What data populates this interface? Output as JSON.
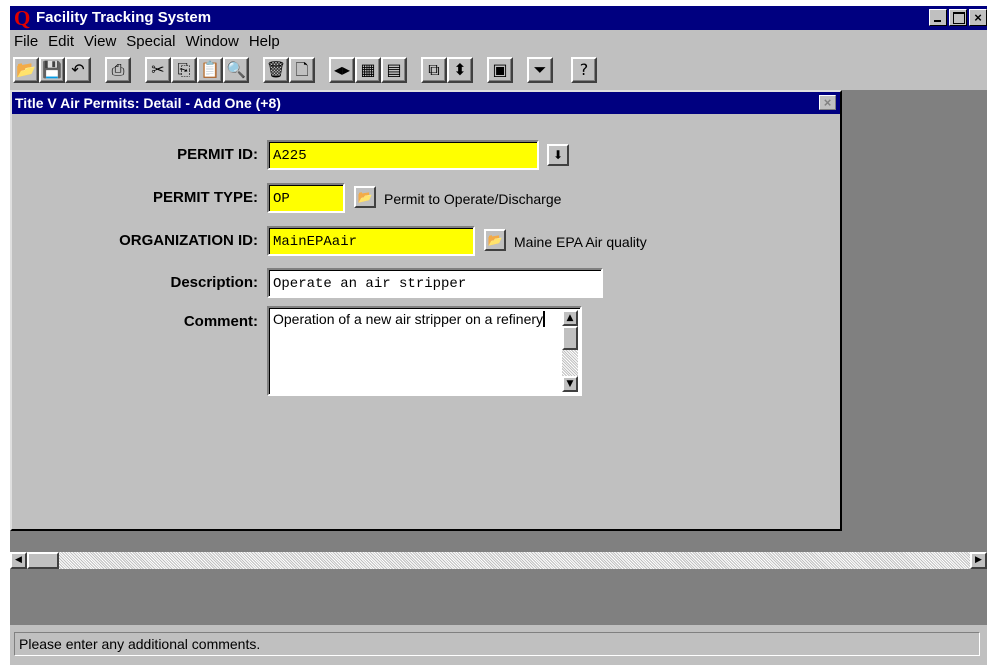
{
  "app": {
    "logo": "Q",
    "title": "Facility Tracking System",
    "window_controls": {
      "minimize": "_",
      "maximize": "□",
      "close": "×"
    }
  },
  "menu": [
    {
      "label": "File"
    },
    {
      "label": "Edit"
    },
    {
      "label": "View"
    },
    {
      "label": "Special"
    },
    {
      "label": "Window"
    },
    {
      "label": "Help"
    }
  ],
  "toolbar": {
    "buttons": [
      {
        "icon": "open-folder-icon",
        "glyph": "📂"
      },
      {
        "icon": "save-disk-icon",
        "glyph": "💾"
      },
      {
        "icon": "undo-icon",
        "glyph": "↶"
      },
      {
        "icon": "print-icon",
        "glyph": "⎙"
      },
      {
        "icon": "cut-icon",
        "glyph": "✂"
      },
      {
        "icon": "copy-icon",
        "glyph": "⎘"
      },
      {
        "icon": "paste-icon",
        "glyph": "📋"
      },
      {
        "icon": "find-icon",
        "glyph": "🔍"
      },
      {
        "icon": "delete-trash-icon",
        "glyph": "🗑"
      },
      {
        "icon": "new-record-icon",
        "glyph": "🗋"
      },
      {
        "icon": "navigate-arrows-icon",
        "glyph": "◂▸"
      },
      {
        "icon": "grid-view-icon",
        "glyph": "▦"
      },
      {
        "icon": "form-view-icon",
        "glyph": "▤"
      },
      {
        "icon": "cascade-windows-icon",
        "glyph": "⧉"
      },
      {
        "icon": "scroll-updown-icon",
        "glyph": "⬍"
      },
      {
        "icon": "calculator-icon",
        "glyph": "▣"
      },
      {
        "icon": "filter-funnel-icon",
        "glyph": "⏷"
      },
      {
        "icon": "help-icon",
        "glyph": "?"
      }
    ]
  },
  "child_window": {
    "title": "Title V Air Permits: Detail - Add One (+8)",
    "close_glyph": "×"
  },
  "form": {
    "permit_id": {
      "label": "PERMIT ID:",
      "value": "A225",
      "dropdown_glyph": "⬇"
    },
    "permit_type": {
      "label": "PERMIT TYPE:",
      "value": "OP",
      "lookup_glyph": "📂",
      "description": "Permit to Operate/Discharge"
    },
    "organization_id": {
      "label": "ORGANIZATION ID:",
      "value": "MainEPAair",
      "lookup_glyph": "📂",
      "description": "Maine EPA Air quality"
    },
    "description": {
      "label": "Description:",
      "value": "Operate an air stripper"
    },
    "comment": {
      "label": "Comment:",
      "value": "Operation of a new air stripper on a refinery"
    }
  },
  "scroll": {
    "up": "▲",
    "down": "▼",
    "left": "◀",
    "right": "▶"
  },
  "colors": {
    "title_bar": "#000080",
    "required_field": "#ffff00",
    "window_bg": "#c0c0c0",
    "workspace": "#808080"
  },
  "status_bar": {
    "text": "Please enter any additional comments."
  }
}
